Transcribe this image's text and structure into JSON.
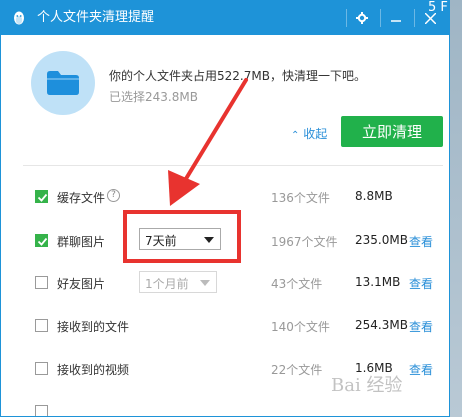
{
  "window": {
    "title": "个人文件夹清理提醒"
  },
  "outside": {
    "partial_text": "5 F"
  },
  "summary": {
    "main_text": "你的个人文件夹占用522.7MB，快清理一下吧。",
    "selected_text": "已选择243.8MB"
  },
  "actions": {
    "collapse_label": "收起",
    "clean_label": "立即清理"
  },
  "rows": [
    {
      "label": "缓存文件",
      "checked": true,
      "count": "136个文件",
      "size": "8.8MB",
      "view": ""
    },
    {
      "label": "群聊图片",
      "checked": true,
      "dropdown": "7天前",
      "count": "1967个文件",
      "size": "235.0MB",
      "view": "查看"
    },
    {
      "label": "好友图片",
      "checked": false,
      "dropdown": "1个月前",
      "count": "43个文件",
      "size": "13.1MB",
      "view": "查看"
    },
    {
      "label": "接收到的文件",
      "checked": false,
      "count": "140个文件",
      "size": "254.3MB",
      "view": "查看"
    },
    {
      "label": "接收到的视频",
      "checked": false,
      "count": "22个文件",
      "size": "1.6MB",
      "view": "查看"
    }
  ],
  "watermark": "Bai 经验",
  "colors": {
    "titlebar": "#1e93d8",
    "accent_green": "#21b14b",
    "link_blue": "#2a8fd8",
    "annotation_red": "#e8332f"
  }
}
